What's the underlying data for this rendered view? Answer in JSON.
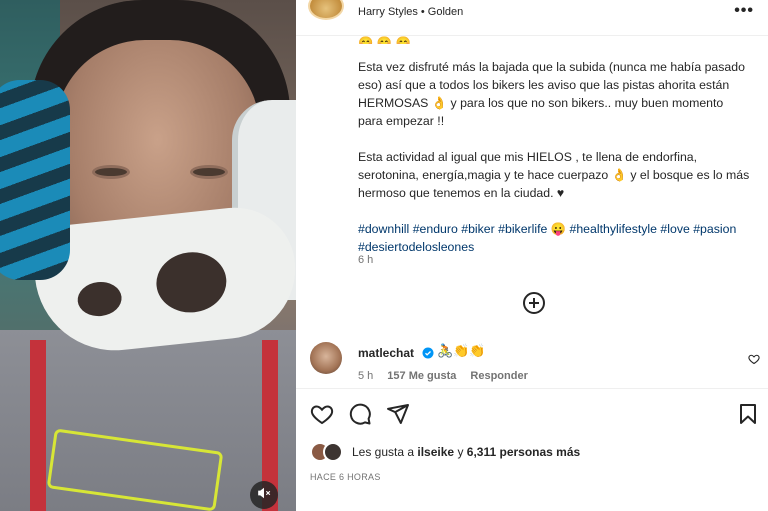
{
  "header": {
    "username": "Harry Styles",
    "separator": "•",
    "audio": "Golden",
    "more_icon": "more-horizontal-icon"
  },
  "caption": {
    "emoji_row": "😊 😊 😊",
    "paragraphs": [
      "Esta vez disfruté más la bajada que la subida (nunca me había pasado eso) así que a todos los bikers les aviso que las pistas ahorita están HERMOSAS 👌 y para los que no son bikers.. muy buen momento para empezar !!",
      "Esta actividad al igual que mis HIELOS , te llena de endorfina, serotonina, energía,magia y te hace cuerpazo 👌 y el bosque es lo más hermoso que tenemos en la ciudad. ♥"
    ],
    "hashtags": "#downhill #enduro #biker #bikerlife 😛 #healthylifestyle #love #pasion #desiertodelosleones",
    "time": "6 h"
  },
  "comment": {
    "username": "matlechat",
    "emojis": "🚴👏👏",
    "time": "5 h",
    "likes": "157 Me gusta",
    "reply": "Responder"
  },
  "likes": {
    "prefix": "Les gusta a",
    "user": "ilseike",
    "conjunction": "y",
    "count": "6,311 personas más"
  },
  "posted_ago": "HACE 6 HORAS",
  "icons": {
    "add": "add-circle-icon",
    "like": "heart-icon",
    "comment": "comment-icon",
    "share": "send-icon",
    "save": "bookmark-icon",
    "mute": "speaker-muted-icon",
    "verified": "verified-badge-icon"
  },
  "colors": {
    "text": "#262626",
    "muted": "#737373",
    "hashtag": "#00376b",
    "verified": "#0095f6"
  }
}
